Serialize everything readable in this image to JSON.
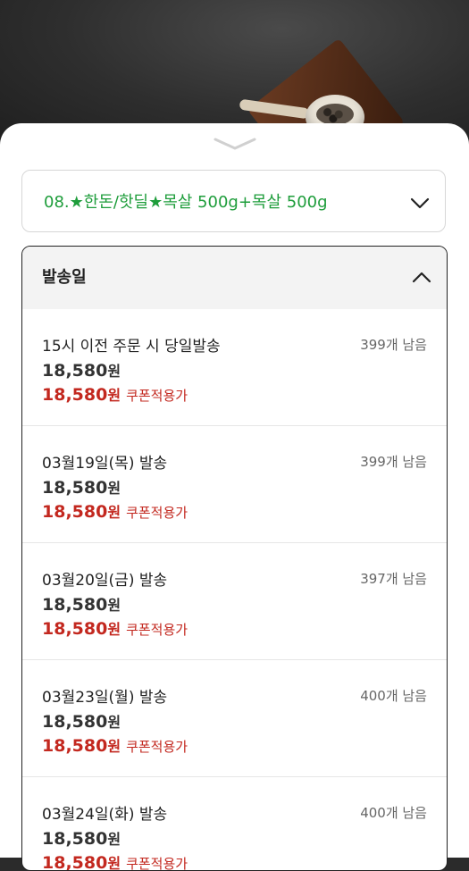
{
  "option_select": {
    "selected_label": "08.★한돈/핫딜★목살 500g+목살 500g"
  },
  "shipping": {
    "header": "발송일",
    "currency_unit": "원",
    "coupon_label": "쿠폰적용가",
    "items": [
      {
        "name": "15시 이전 주문 시 당일발송",
        "stock": "399개 남음",
        "price": "18,580",
        "coupon_price": "18,580"
      },
      {
        "name": "03월19일(목) 발송",
        "stock": "399개 남음",
        "price": "18,580",
        "coupon_price": "18,580"
      },
      {
        "name": "03월20일(금) 발송",
        "stock": "397개 남음",
        "price": "18,580",
        "coupon_price": "18,580"
      },
      {
        "name": "03월23일(월) 발송",
        "stock": "400개 남음",
        "price": "18,580",
        "coupon_price": "18,580"
      },
      {
        "name": "03월24일(화) 발송",
        "stock": "400개 남음",
        "price": "18,580",
        "coupon_price": "18,580"
      }
    ]
  },
  "colors": {
    "option_text": "#1e9d3b",
    "coupon_red": "#c3281f",
    "panel_border": "#222222"
  },
  "icons": {
    "sheet_handle": "chevron-down-icon",
    "option_dropdown": "chevron-down-icon",
    "shipping_collapse": "chevron-up-icon"
  }
}
